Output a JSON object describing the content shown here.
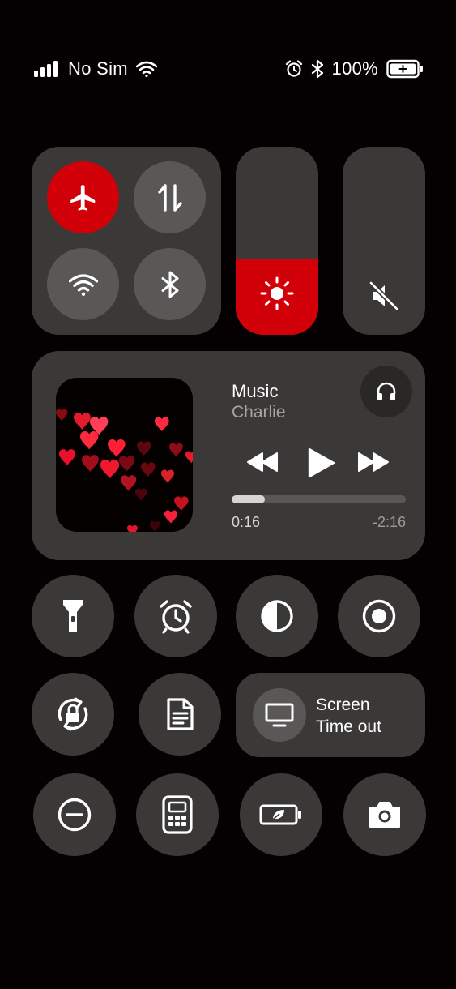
{
  "status_bar": {
    "carrier": "No Sim",
    "battery_percent": "100%",
    "signal_bars_active": 4
  },
  "connectivity": {
    "airplane_mode": true,
    "mobile_data": false,
    "wifi": false,
    "bluetooth": false
  },
  "sliders": {
    "brightness_level": 0.4,
    "volume_level": 0.0,
    "muted": true
  },
  "media": {
    "app": "Music",
    "artist": "Charlie",
    "elapsed": "0:16",
    "remaining": "-2:16",
    "progress": 0.19
  },
  "screen_timeout": {
    "label_line1": "Screen",
    "label_line2": "Time out"
  },
  "colors": {
    "accent": "#d10009",
    "panel": "#3b3838",
    "inner": "#5a5757",
    "background": "#050102"
  }
}
